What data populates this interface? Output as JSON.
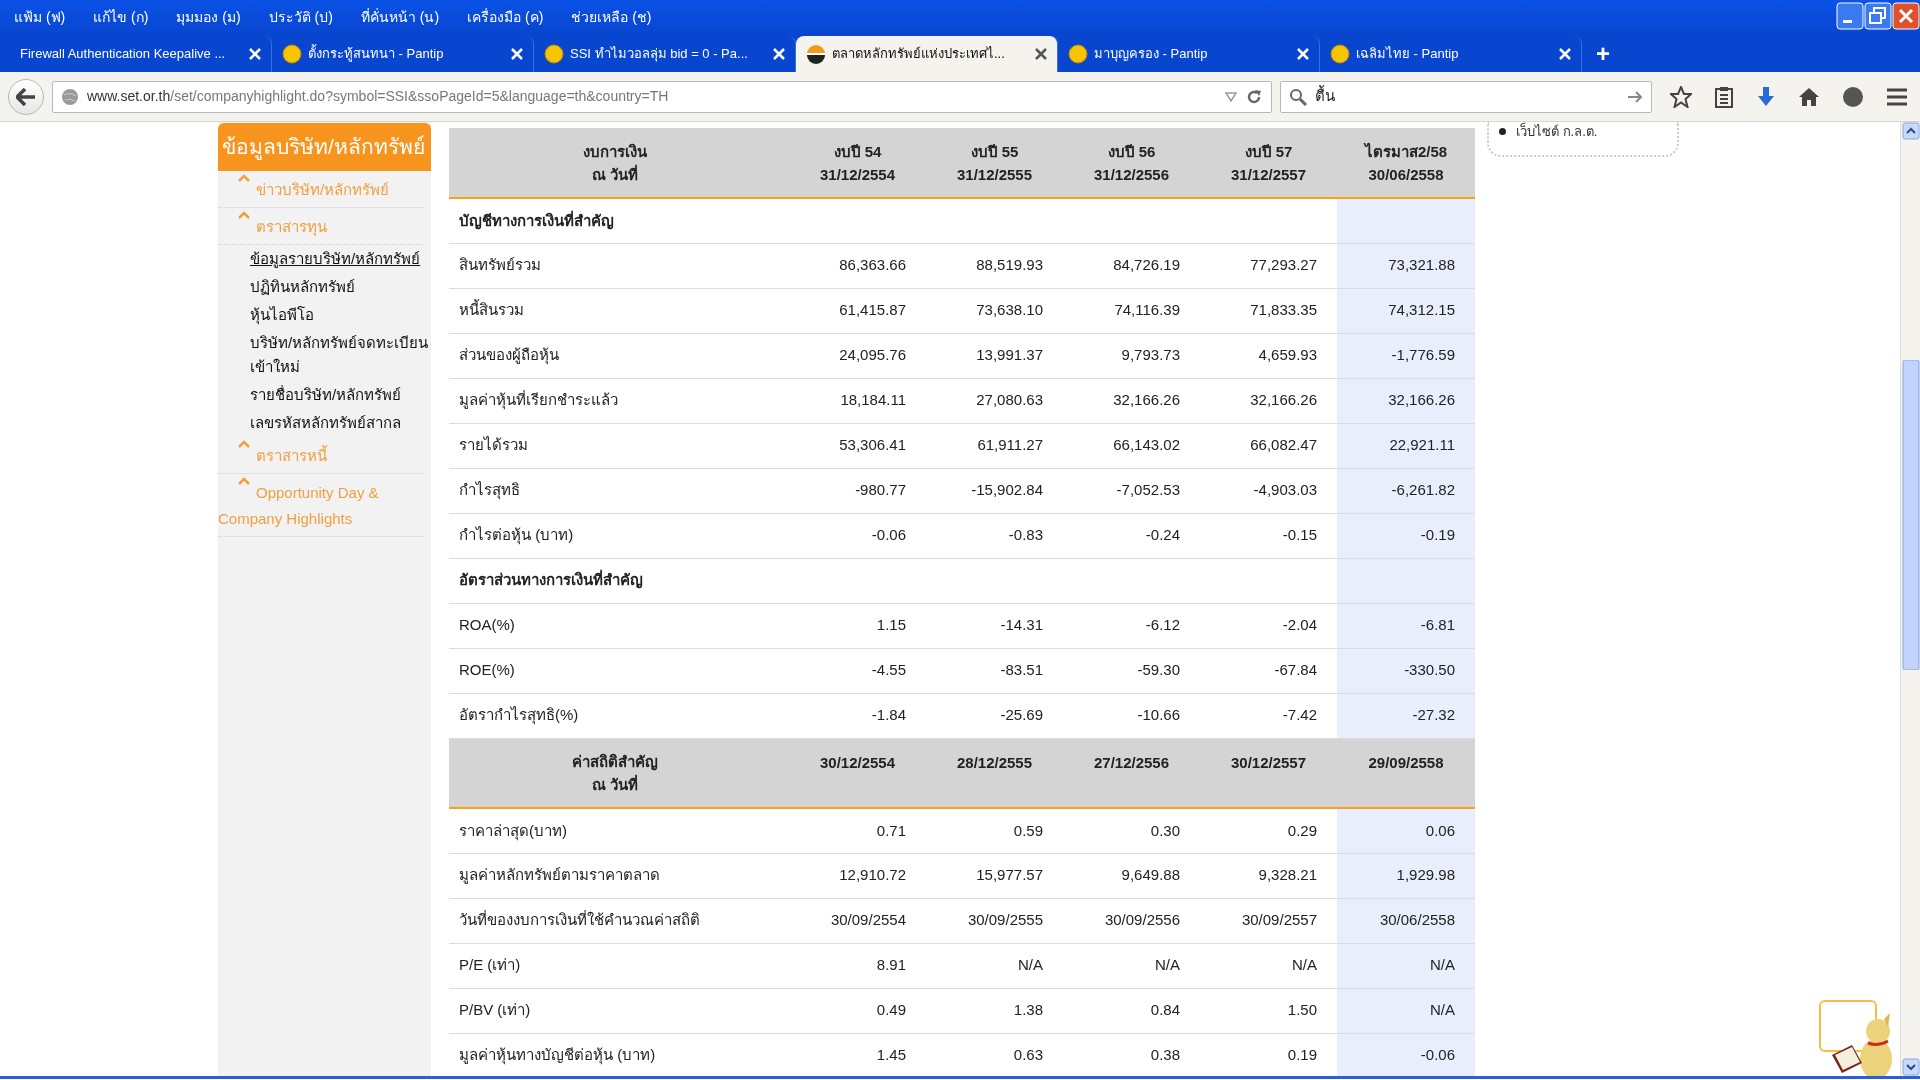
{
  "menu": [
    "แฟ้ม (ฟ)",
    "แก้ไข (ก)",
    "มุมมอง (ม)",
    "ประวัติ (ป)",
    "ที่คั่นหน้า (น)",
    "เครื่องมือ (ค)",
    "ช่วยเหลือ (ช)"
  ],
  "tabs": [
    {
      "title": "Firewall Authentication Keepalive ...",
      "kind": "plain",
      "selected": false
    },
    {
      "title": "ตั้งกระทู้สนทนา - Pantip",
      "kind": "emoji",
      "selected": false
    },
    {
      "title": "SSI ทำไมวอลลุ่ม bid = 0 - Pa...",
      "kind": "emoji",
      "selected": false
    },
    {
      "title": "ตลาดหลักทรัพย์แห่งประเทศไ...",
      "kind": "logo",
      "selected": true
    },
    {
      "title": "มาบุญครอง - Pantip",
      "kind": "emoji",
      "selected": false
    },
    {
      "title": "เฉลิมไทย - Pantip",
      "kind": "emoji",
      "selected": false
    }
  ],
  "new_tab_label": "+",
  "address": {
    "host": "www.set.or.th",
    "path": "/set/companyhighlight.do?symbol=SSI&ssoPageId=5&language=th&country=TH"
  },
  "search": {
    "value": "ตื้น"
  },
  "sidebar": {
    "title": "ข้อมูลบริษัท/หลักทรัพย์",
    "items": [
      {
        "label": "ข่าวบริษัท/หลักทรัพย์"
      },
      {
        "label": "ตราสารทุน",
        "children": [
          {
            "label": "ข้อมูลรายบริษัท/หลักทรัพย์",
            "selected": true
          },
          {
            "label": "ปฏิทินหลักทรัพย์",
            "selected": false
          },
          {
            "label": "หุ้นไอพีโอ",
            "selected": false
          },
          {
            "label": "บริษัท/หลักทรัพย์จดทะเบียนเข้าใหม่",
            "selected": false
          },
          {
            "label": "รายชื่อบริษัท/หลักทรัพย์",
            "selected": false
          },
          {
            "label": "เลขรหัสหลักทรัพย์สากล",
            "selected": false
          }
        ]
      },
      {
        "label": "ตราสารหนี้"
      },
      {
        "label": "Opportunity Day & Company Highlights"
      }
    ]
  },
  "side_box": {
    "items": [
      "เว็บไซต์ ก.ล.ต."
    ]
  },
  "table": {
    "rows": [
      {
        "kind": "header",
        "label": [
          "งบการเงิน",
          "ณ วันที่"
        ],
        "cells": [
          [
            "งบปี 54",
            "31/12/2554"
          ],
          [
            "งบปี 55",
            "31/12/2555"
          ],
          [
            "งบปี 56",
            "31/12/2556"
          ],
          [
            "งบปี 57",
            "31/12/2557"
          ],
          [
            "ไตรมาส2/58",
            "30/06/2558"
          ]
        ]
      },
      {
        "kind": "section",
        "label": "บัญชีทางการเงินที่สำคัญ"
      },
      {
        "kind": "data",
        "label": "สินทรัพย์รวม",
        "cells": [
          "86,363.66",
          "88,519.93",
          "84,726.19",
          "77,293.27",
          "73,321.88"
        ]
      },
      {
        "kind": "data",
        "label": "หนี้สินรวม",
        "cells": [
          "61,415.87",
          "73,638.10",
          "74,116.39",
          "71,833.35",
          "74,312.15"
        ]
      },
      {
        "kind": "data",
        "label": "ส่วนของผู้ถือหุ้น",
        "cells": [
          "24,095.76",
          "13,991.37",
          "9,793.73",
          "4,659.93",
          "-1,776.59"
        ]
      },
      {
        "kind": "data",
        "label": "มูลค่าหุ้นที่เรียกชำระแล้ว",
        "cells": [
          "18,184.11",
          "27,080.63",
          "32,166.26",
          "32,166.26",
          "32,166.26"
        ]
      },
      {
        "kind": "data",
        "label": "รายได้รวม",
        "cells": [
          "53,306.41",
          "61,911.27",
          "66,143.02",
          "66,082.47",
          "22,921.11"
        ]
      },
      {
        "kind": "data",
        "label": "กำไรสุทธิ",
        "cells": [
          "-980.77",
          "-15,902.84",
          "-7,052.53",
          "-4,903.03",
          "-6,261.82"
        ]
      },
      {
        "kind": "data",
        "label": "กำไรต่อหุ้น (บาท)",
        "cells": [
          "-0.06",
          "-0.83",
          "-0.24",
          "-0.15",
          "-0.19"
        ]
      },
      {
        "kind": "section",
        "label": "อัตราส่วนทางการเงินที่สำคัญ"
      },
      {
        "kind": "data",
        "label": "ROA(%)",
        "cells": [
          "1.15",
          "-14.31",
          "-6.12",
          "-2.04",
          "-6.81"
        ]
      },
      {
        "kind": "data",
        "label": "ROE(%)",
        "cells": [
          "-4.55",
          "-83.51",
          "-59.30",
          "-67.84",
          "-330.50"
        ]
      },
      {
        "kind": "data",
        "label": "อัตรากำไรสุทธิ(%)",
        "cells": [
          "-1.84",
          "-25.69",
          "-10.66",
          "-7.42",
          "-27.32"
        ]
      },
      {
        "kind": "header",
        "label": [
          "ค่าสถิติสำคัญ",
          "ณ วันที่"
        ],
        "cells": [
          [
            "30/12/2554"
          ],
          [
            "28/12/2555"
          ],
          [
            "27/12/2556"
          ],
          [
            "30/12/2557"
          ],
          [
            "29/09/2558"
          ]
        ]
      },
      {
        "kind": "data",
        "label": "ราคาล่าสุด(บาท)",
        "cells": [
          "0.71",
          "0.59",
          "0.30",
          "0.29",
          "0.06"
        ]
      },
      {
        "kind": "data",
        "label": "มูลค่าหลักทรัพย์ตามราคาตลาด",
        "cells": [
          "12,910.72",
          "15,977.57",
          "9,649.88",
          "9,328.21",
          "1,929.98"
        ]
      },
      {
        "kind": "data",
        "label": "วันที่ของงบการเงินที่ใช้คำนวณค่าสถิติ",
        "cells": [
          "30/09/2554",
          "30/09/2555",
          "30/09/2556",
          "30/09/2557",
          "30/06/2558"
        ]
      },
      {
        "kind": "data",
        "label": "P/E (เท่า)",
        "cells": [
          "8.91",
          "N/A",
          "N/A",
          "N/A",
          "N/A"
        ]
      },
      {
        "kind": "data",
        "label": "P/BV (เท่า)",
        "cells": [
          "0.49",
          "1.38",
          "0.84",
          "1.50",
          "N/A"
        ]
      },
      {
        "kind": "data",
        "label": "มูลค่าหุ้นทางบัญชีต่อหุ้น (บาท)",
        "cells": [
          "1.45",
          "0.63",
          "0.38",
          "0.19",
          "-0.06"
        ]
      }
    ]
  }
}
